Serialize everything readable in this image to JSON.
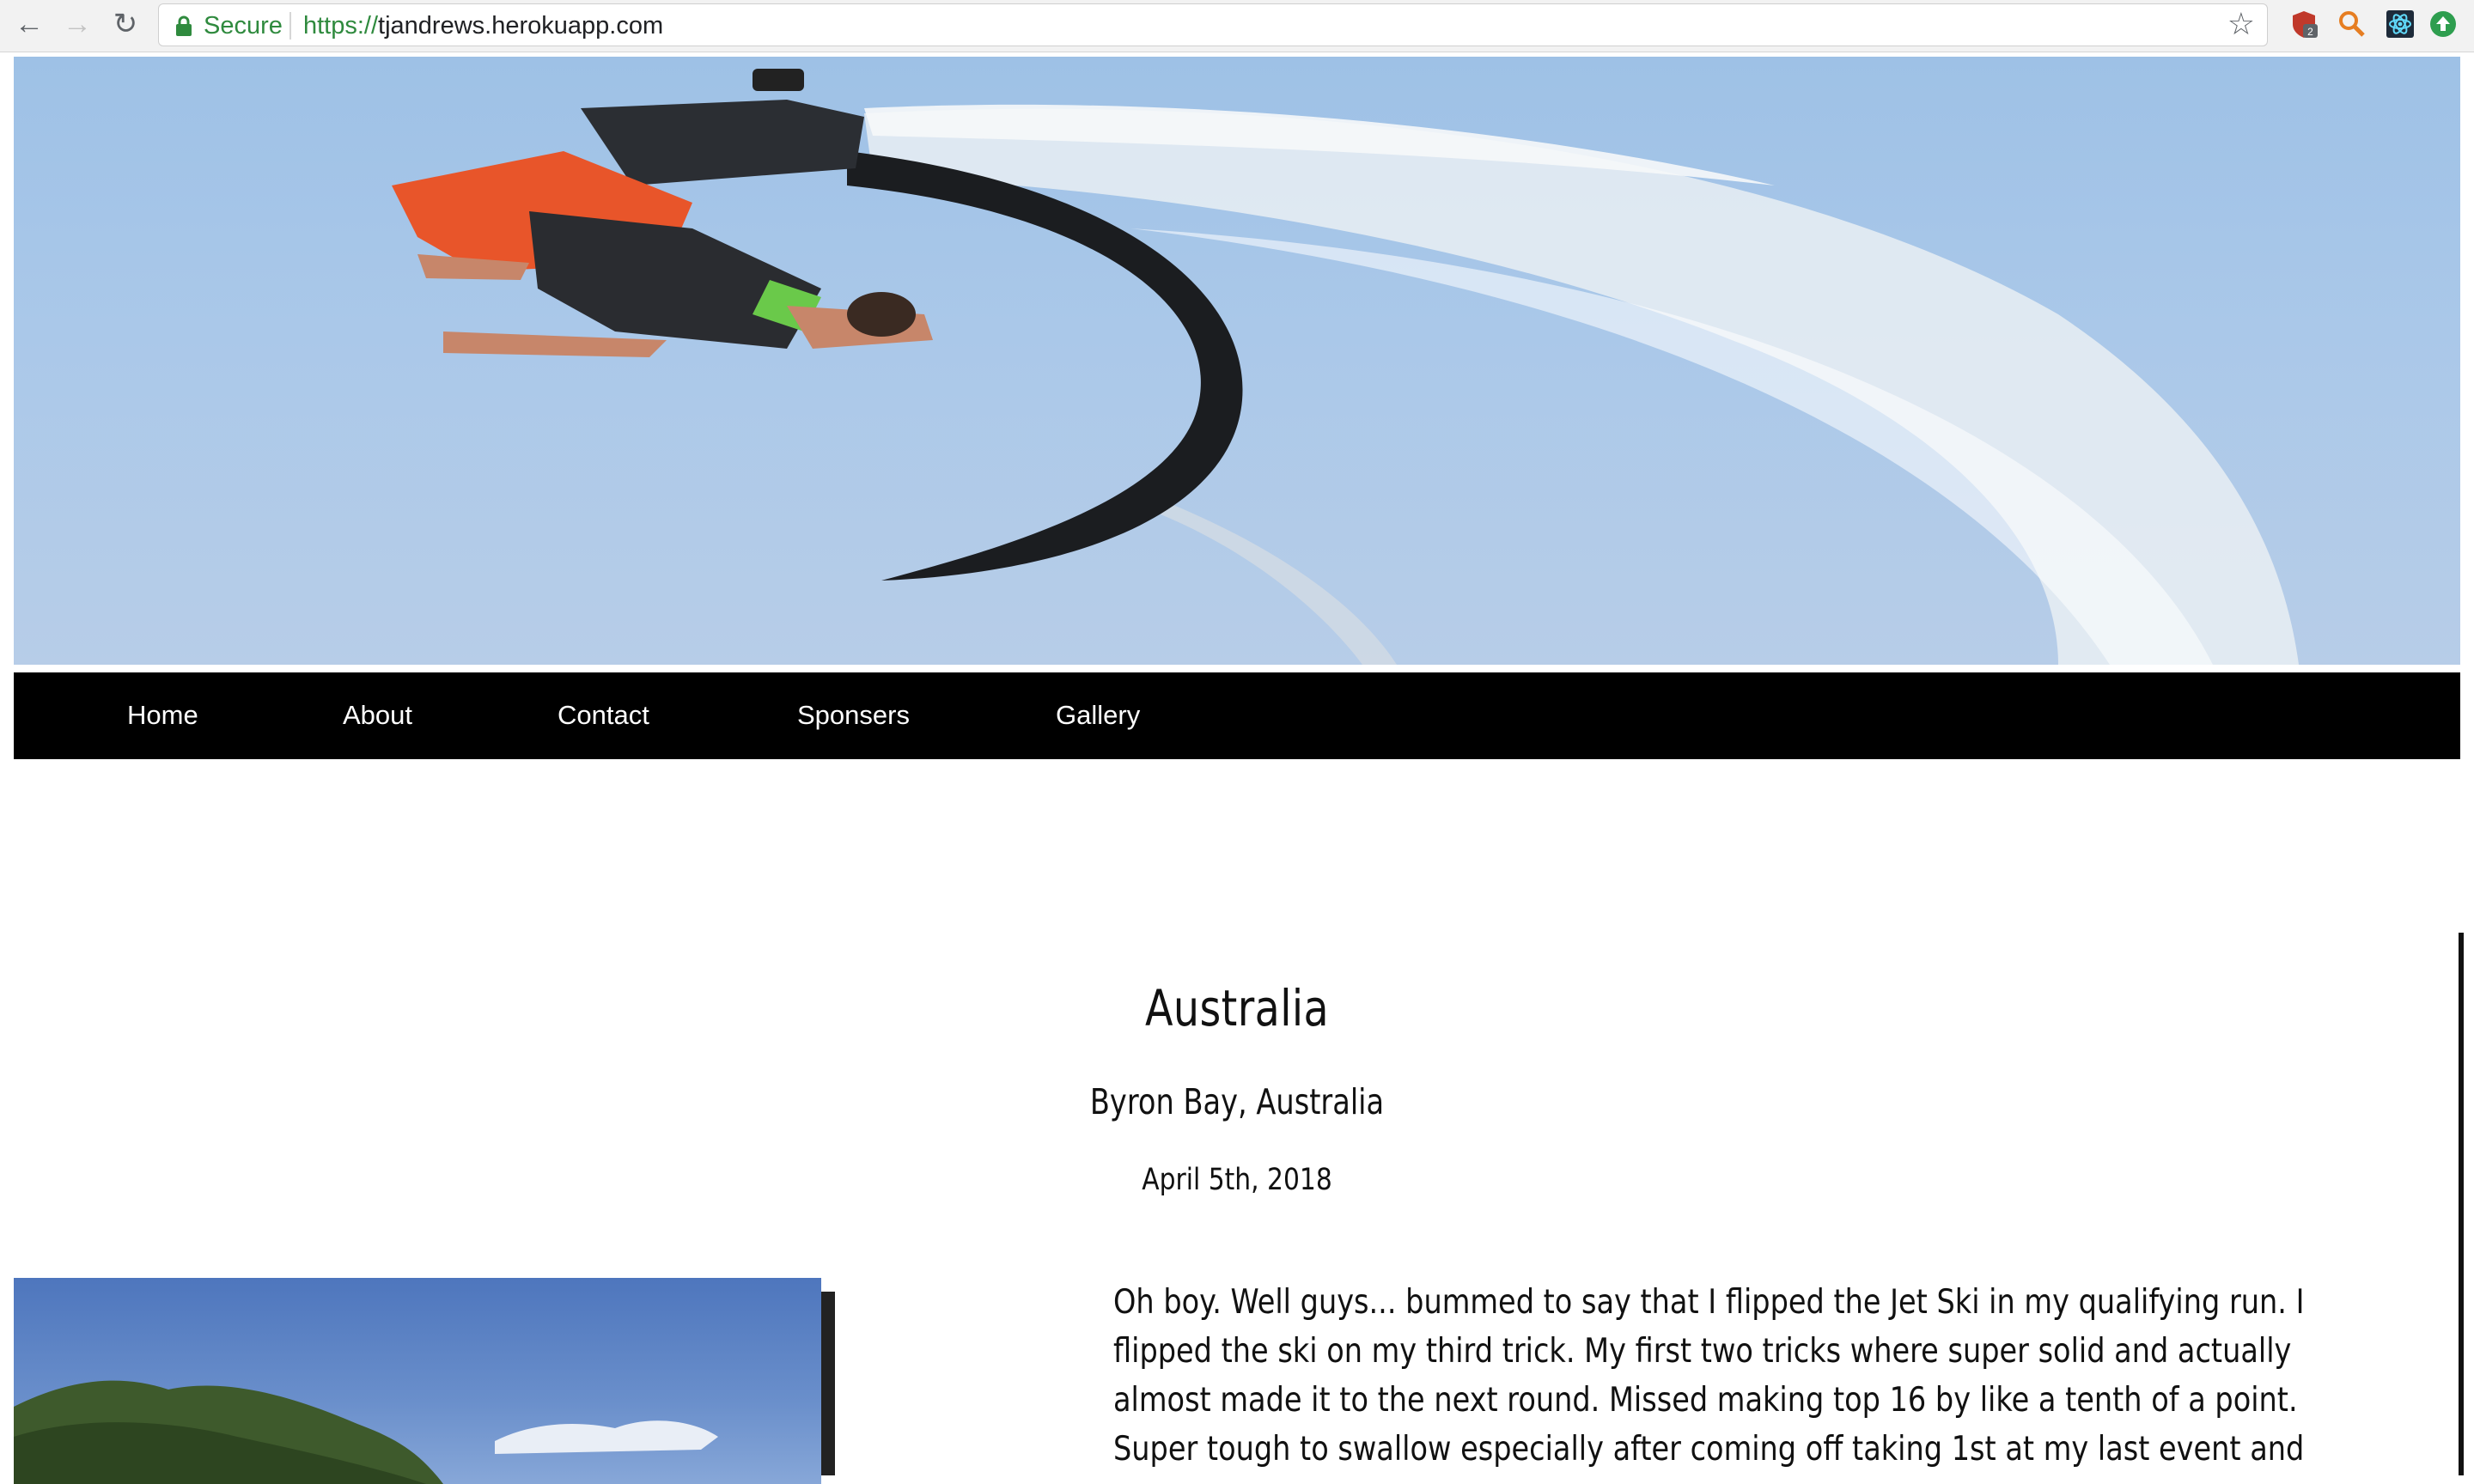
{
  "browser": {
    "secure_label": "Secure",
    "url_scheme": "https://",
    "url_host": "tjandrews.herokuapp.com",
    "extension_badge": "2"
  },
  "nav": {
    "items": [
      {
        "label": "Home"
      },
      {
        "label": "About"
      },
      {
        "label": "Contact"
      },
      {
        "label": "Sponsers"
      },
      {
        "label": "Gallery"
      }
    ]
  },
  "post": {
    "title": "Australia",
    "location": "Byron Bay, Australia",
    "date": "April 5th, 2018",
    "body_lines": [
      "Oh boy. Well guys... bummed to say that I flipped the Jet Ski in my qualifying run. I",
      "flipped the ski on my third trick. My first two tricks where super solid and actually",
      "almost made it to the next round. Missed making top 16 by like a tenth of a point.",
      "Super tough to swallow especially after coming off taking 1st at my last event and"
    ]
  },
  "colors": {
    "navbar_bg": "#000000",
    "nav_text": "#ffffff",
    "secure_green": "#2f8a3e"
  }
}
